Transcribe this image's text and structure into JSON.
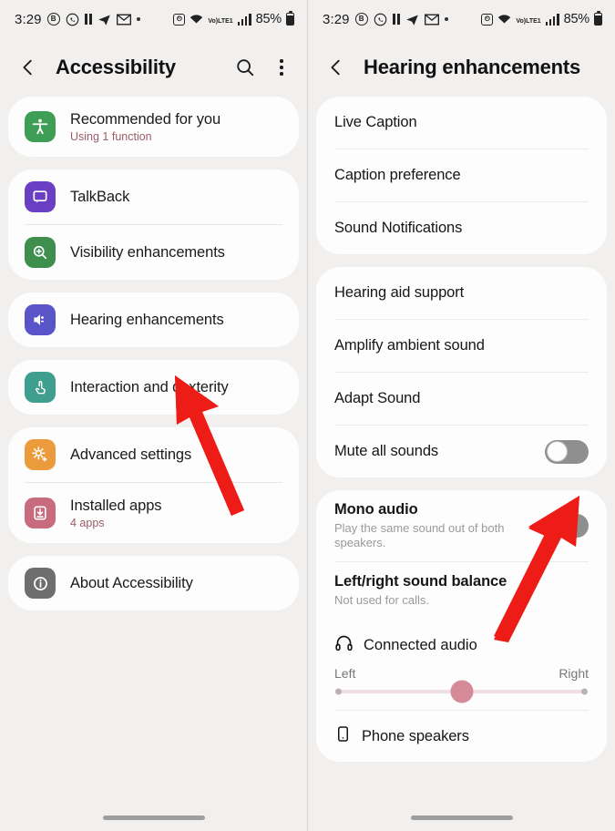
{
  "status_bar": {
    "time": "3:29",
    "battery": "85%",
    "network": "LTE1",
    "network_top": "Vo)",
    "left_icons": [
      "badge-b-icon",
      "whatsapp-icon",
      "pause-icon",
      "telegram-icon",
      "gmail-icon",
      "dot-icon"
    ],
    "right_icons": [
      "alarm-icon",
      "wifi-icon",
      "lte-icon",
      "signal-icon",
      "battery-icon"
    ]
  },
  "left_screen": {
    "appbar": {
      "title": "Accessibility",
      "back_label": "back-icon",
      "search_label": "search-icon",
      "more_label": "more-options-icon"
    },
    "groups": [
      {
        "rows": [
          {
            "title": "Recommended for you",
            "subtitle": "Using 1 function",
            "icon": "accessibility-person-icon",
            "icon_color": "#3e9e55"
          }
        ]
      },
      {
        "rows": [
          {
            "title": "TalkBack",
            "subtitle": "",
            "icon": "talkback-speech-icon",
            "icon_color": "#6a3fc4"
          },
          {
            "title": "Visibility enhancements",
            "subtitle": "",
            "icon": "magnifier-plus-icon",
            "icon_color": "#3e8f4e"
          }
        ]
      },
      {
        "rows": [
          {
            "title": "Hearing enhancements",
            "subtitle": "",
            "icon": "speaker-wave-icon",
            "icon_color": "#5a54c9"
          }
        ]
      },
      {
        "rows": [
          {
            "title": "Interaction and dexterity",
            "subtitle": "",
            "icon": "hand-tap-icon",
            "icon_color": "#3f9e8e"
          }
        ]
      },
      {
        "rows": [
          {
            "title": "Advanced settings",
            "subtitle": "",
            "icon": "gear-plus-icon",
            "icon_color": "#eb9b3c"
          },
          {
            "title": "Installed apps",
            "subtitle": "4 apps",
            "icon": "download-box-icon",
            "icon_color": "#c96b7e"
          }
        ]
      },
      {
        "rows": [
          {
            "title": "About Accessibility",
            "subtitle": "",
            "icon": "info-icon",
            "icon_color": "#6e6e6e"
          }
        ]
      }
    ]
  },
  "right_screen": {
    "appbar": {
      "title": "Hearing enhancements",
      "back_label": "back-icon"
    },
    "group1": [
      {
        "title": "Live Caption"
      },
      {
        "title": "Caption preference"
      },
      {
        "title": "Sound Notifications"
      }
    ],
    "group2": [
      {
        "title": "Hearing aid support"
      },
      {
        "title": "Amplify ambient sound"
      },
      {
        "title": "Adapt Sound"
      },
      {
        "title": "Mute all sounds",
        "toggle": "off"
      }
    ],
    "group3": {
      "mono_audio": {
        "title": "Mono audio",
        "subtitle": "Play the same sound out of both speakers.",
        "toggle": "off"
      },
      "balance": {
        "title": "Left/right sound balance",
        "subtitle": "Not used for calls."
      },
      "connected_audio": {
        "title": "Connected audio",
        "icon": "headphones-icon",
        "left_label": "Left",
        "right_label": "Right",
        "value_percent": 50
      },
      "phone_speakers": {
        "title": "Phone speakers",
        "icon": "phone-icon"
      }
    }
  },
  "annotations": {
    "arrow_color": "#ee1c16",
    "arrows": [
      {
        "name": "arrow-to-hearing-enhancements"
      },
      {
        "name": "arrow-to-mute-all-sounds-toggle"
      }
    ]
  }
}
